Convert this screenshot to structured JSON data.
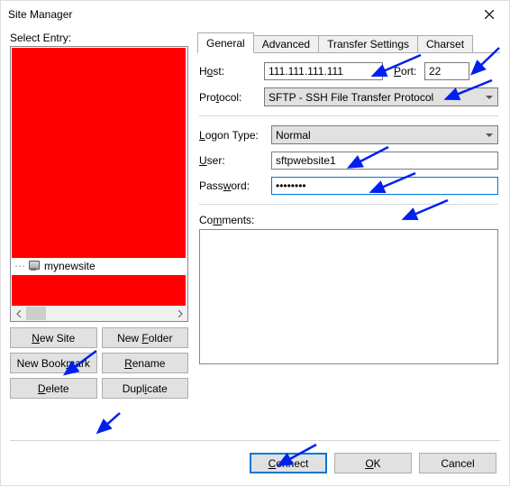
{
  "window": {
    "title": "Site Manager"
  },
  "left": {
    "select_label": "Select Entry:",
    "site_name": "mynewsite",
    "buttons": {
      "new_site": "New Site",
      "new_folder": "New Folder",
      "new_bookmark": "New Bookmark",
      "rename": "Rename",
      "delete": "Delete",
      "duplicate": "Duplicate"
    }
  },
  "tabs": {
    "general": "General",
    "advanced": "Advanced",
    "transfer": "Transfer Settings",
    "charset": "Charset"
  },
  "form": {
    "host_label_pre": "H",
    "host_label_u": "o",
    "host_label_post": "st:",
    "host_value": "111.111.111.111",
    "port_label_pre": "",
    "port_label_u": "P",
    "port_label_post": "ort:",
    "port_value": "22",
    "protocol_label_pre": "Pro",
    "protocol_label_u": "t",
    "protocol_label_post": "ocol:",
    "protocol_value": "SFTP - SSH File Transfer Protocol",
    "logon_label_pre": "",
    "logon_label_u": "L",
    "logon_label_post": "ogon Type:",
    "logon_value": "Normal",
    "user_label_pre": "",
    "user_label_u": "U",
    "user_label_post": "ser:",
    "user_value": "sftpwebsite1",
    "pass_label_pre": "Pass",
    "pass_label_u": "w",
    "pass_label_post": "ord:",
    "pass_value": "••••••••",
    "comments_label_pre": "Co",
    "comments_label_u": "m",
    "comments_label_post": "ments:",
    "comments_value": ""
  },
  "bottom": {
    "connect": "Connect",
    "ok": "OK",
    "cancel": "Cancel"
  }
}
